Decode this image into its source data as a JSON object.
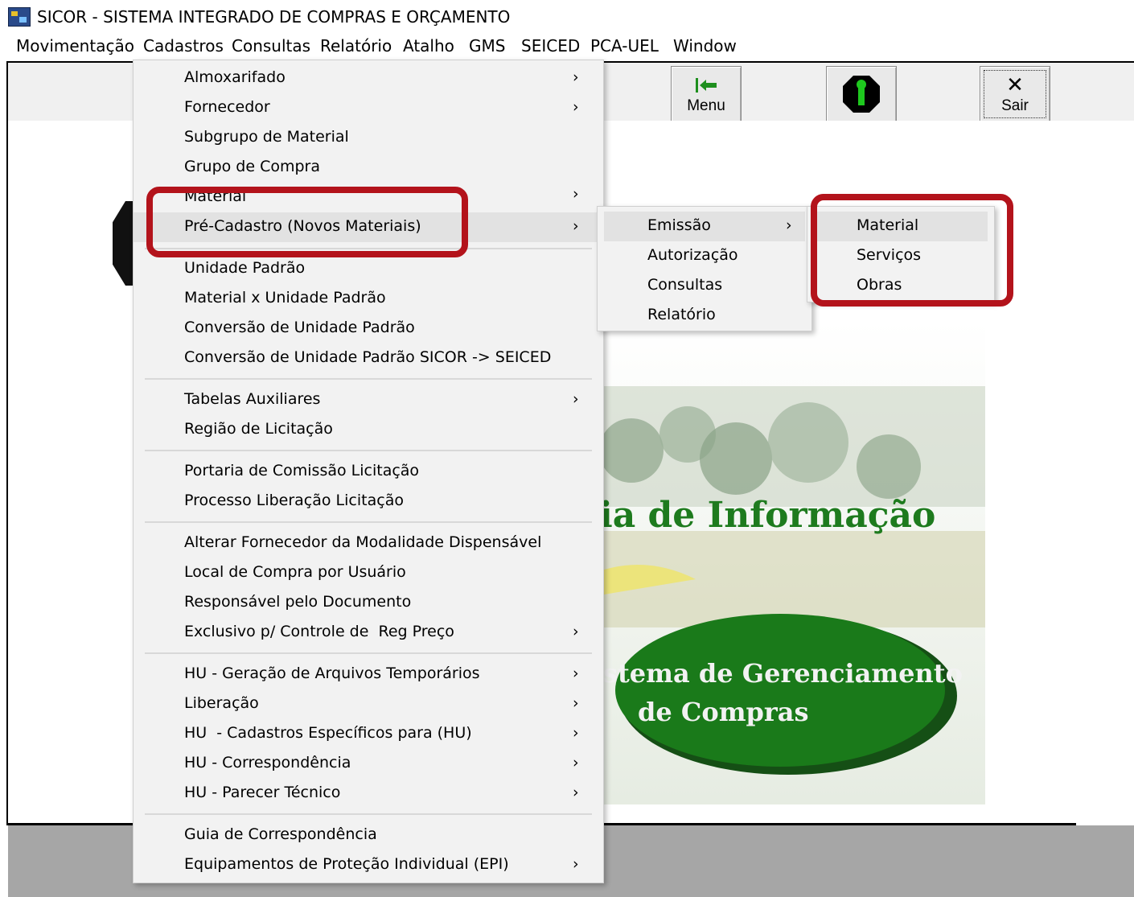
{
  "window": {
    "title": "SICOR - SISTEMA INTEGRADO DE COMPRAS E ORÇAMENTO"
  },
  "menubar": {
    "items": [
      "Movimentação",
      "Cadastros",
      "Consultas",
      "Relatório",
      "Atalho",
      "GMS",
      "SEICED",
      "PCA-UEL",
      "Window"
    ]
  },
  "toolbar": {
    "menu_label": "Menu",
    "exit_label": "Sair"
  },
  "splash": {
    "line1": "ia de Informação",
    "line2": "stema de Gerenciamento",
    "line3": "de Compras"
  },
  "cadastros_menu": {
    "items": [
      {
        "label": "Almoxarifado",
        "submenu": true
      },
      {
        "label": "Fornecedor",
        "submenu": true
      },
      {
        "label": "Subgrupo de Material",
        "submenu": false
      },
      {
        "label": "Grupo de Compra",
        "submenu": false
      },
      {
        "label": "Material",
        "submenu": true
      },
      {
        "label": "Pré-Cadastro (Novos Materiais)",
        "submenu": true,
        "highlighted": true
      },
      {
        "label": "Unidade Padrão",
        "submenu": false
      },
      {
        "label": "Material x Unidade Padrão",
        "submenu": false
      },
      {
        "label": "Conversão de Unidade Padrão",
        "submenu": false
      },
      {
        "label": "Conversão de Unidade Padrão SICOR -> SEICED",
        "submenu": false
      },
      {
        "label": "Tabelas Auxiliares",
        "submenu": true
      },
      {
        "label": "Região de Licitação",
        "submenu": false
      },
      {
        "label": "Portaria de Comissão Licitação",
        "submenu": false
      },
      {
        "label": "Processo Liberação Licitação",
        "submenu": false
      },
      {
        "label": "Alterar Fornecedor da Modalidade Dispensável",
        "submenu": false
      },
      {
        "label": "Local de Compra por Usuário",
        "submenu": false
      },
      {
        "label": "Responsável pelo Documento",
        "submenu": false
      },
      {
        "label": "Exclusivo p/ Controle de  Reg Preço",
        "submenu": true
      },
      {
        "label": "HU - Geração de Arquivos Temporários",
        "submenu": true
      },
      {
        "label": "Liberação",
        "submenu": true
      },
      {
        "label": "HU  - Cadastros Específicos para (HU)",
        "submenu": true
      },
      {
        "label": "HU - Correspondência",
        "submenu": true
      },
      {
        "label": "HU - Parecer Técnico",
        "submenu": true
      },
      {
        "label": "Guia de Correspondência",
        "submenu": false
      },
      {
        "label": "Equipamentos de Proteção Individual (EPI)",
        "submenu": true
      }
    ]
  },
  "precadastro_menu": {
    "items": [
      {
        "label": "Emissão",
        "submenu": true,
        "highlighted": true
      },
      {
        "label": "Autorização",
        "submenu": false
      },
      {
        "label": "Consultas",
        "submenu": false
      },
      {
        "label": "Relatório",
        "submenu": false
      }
    ]
  },
  "emissao_menu": {
    "items": [
      {
        "label": "Material",
        "highlighted": true
      },
      {
        "label": "Serviços"
      },
      {
        "label": "Obras"
      }
    ]
  },
  "colors": {
    "highlight_box": "#b3131b",
    "menu_bg": "#f2f2f2",
    "splash_green": "#1e7b1e"
  }
}
